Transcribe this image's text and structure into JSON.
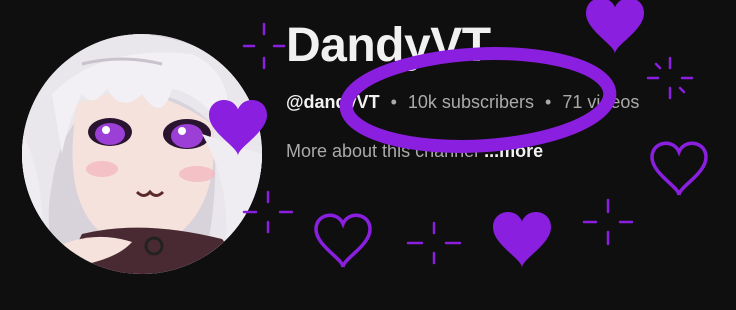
{
  "channel": {
    "name": "DandyVT",
    "handle": "@dandyVT",
    "subscribers": "10k subscribers",
    "videos": "71 videos",
    "separator": "•",
    "about_text": "More about this channel",
    "more_label": "...more"
  },
  "colors": {
    "background": "#0f0f0f",
    "accent_purple": "#8a1fe0",
    "text_primary": "#f1f1f1",
    "text_secondary": "#aaaaaa"
  },
  "decorations": {
    "hearts": [
      "heart-icon",
      "heart-outline-icon"
    ],
    "sparkles": "sparkle-icon",
    "highlight": "purple-ellipse-highlight"
  }
}
